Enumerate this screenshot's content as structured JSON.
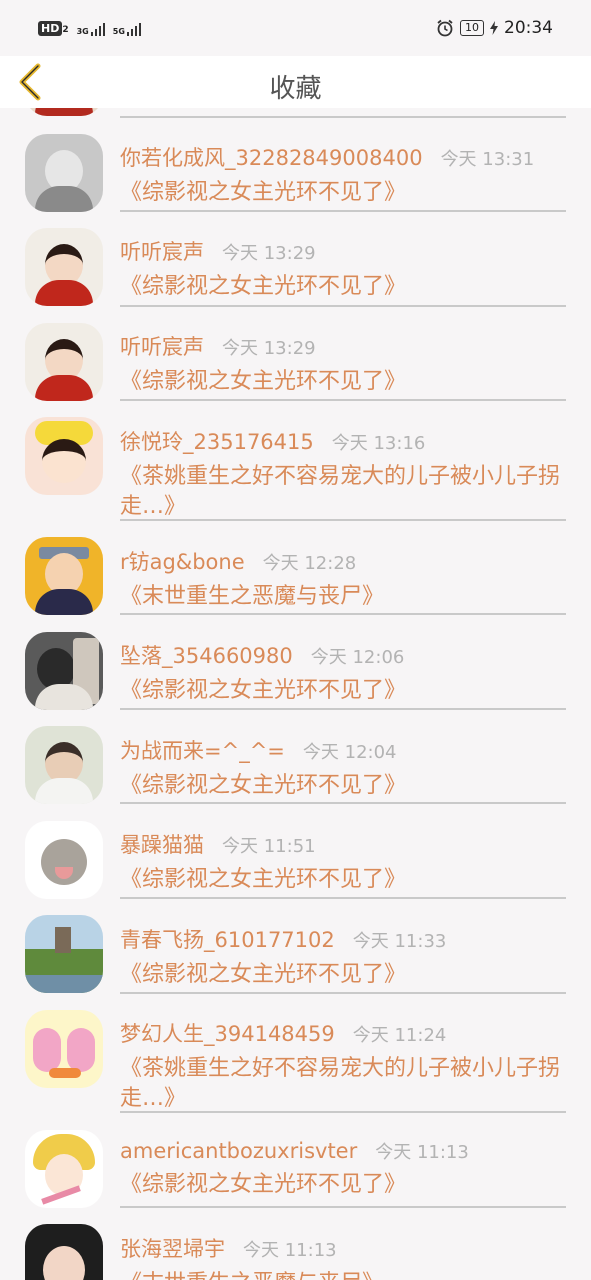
{
  "status_bar": {
    "hd": "HD",
    "hd_sub": "2",
    "sim1_net": "3G",
    "sim2_net": "5G",
    "battery": "10",
    "time": "20:34"
  },
  "header": {
    "title": "收藏"
  },
  "colors": {
    "accent": "#d98a58",
    "time_gray": "#b3b3b3",
    "back_arrow": "#e5b72e"
  },
  "items": [
    {
      "user": "你若化成风_32282849008400",
      "time": "今天 13:31",
      "book": "《综影视之女主光环不见了》",
      "avatar_icon": "girl-fan-grayscale-avatar"
    },
    {
      "user": "听听宸声",
      "time": "今天 13:29",
      "book": "《综影视之女主光环不见了》",
      "avatar_icon": "girl-red-dress-avatar"
    },
    {
      "user": "听听宸声",
      "time": "今天 13:29",
      "book": "《综影视之女主光环不见了》",
      "avatar_icon": "girl-red-dress-avatar"
    },
    {
      "user": "徐悦玲_235176415",
      "time": "今天 13:16",
      "book": "《茶姚重生之好不容易宠大的儿子被小儿子拐走…》",
      "avatar_icon": "cartoon-girl-bow-avatar"
    },
    {
      "user": "r钫ag&bone",
      "time": "今天 12:28",
      "book": "《末世重生之恶魔与丧尸》",
      "avatar_icon": "anime-ninja-avatar"
    },
    {
      "user": "坠落_354660980",
      "time": "今天 12:06",
      "book": "《综影视之女主光环不见了》",
      "avatar_icon": "mirror-selfie-avatar"
    },
    {
      "user": "为战而来=^_^=",
      "time": "今天 12:04",
      "book": "《综影视之女主光环不见了》",
      "avatar_icon": "boy-photo-avatar"
    },
    {
      "user": "暴躁猫猫",
      "time": "今天 11:51",
      "book": "《综影视之女主光环不见了》",
      "avatar_icon": "kitten-avatar"
    },
    {
      "user": "青春飞扬_610177102",
      "time": "今天 11:33",
      "book": "《综影视之女主光环不见了》",
      "avatar_icon": "castle-landscape-avatar"
    },
    {
      "user": "梦幻人生_394148459",
      "time": "今天 11:24",
      "book": "《茶姚重生之好不容易宠大的儿子被小儿子拐走…》",
      "avatar_icon": "pink-bunnies-avatar"
    },
    {
      "user": "americantbozuxrisvter",
      "time": "今天 11:13",
      "book": "《综影视之女主光环不见了》",
      "avatar_icon": "anime-blonde-avatar"
    },
    {
      "user": "张海翌埽宇",
      "time": "今天 11:13",
      "book": "《末世重生之恶魔与丧尸》",
      "avatar_icon": "child-photo-avatar"
    }
  ]
}
